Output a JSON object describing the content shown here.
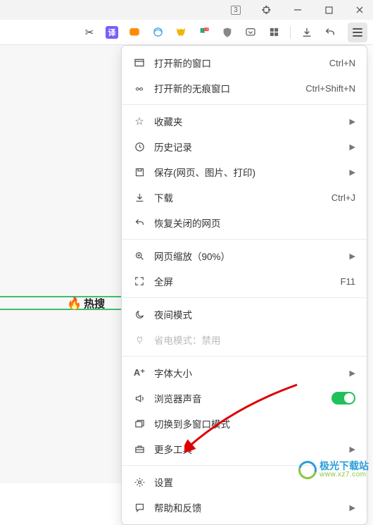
{
  "titlebar": {
    "tab_count": "3"
  },
  "toolbar": {
    "translate_label": "译"
  },
  "hot": {
    "label": "热搜"
  },
  "menu": {
    "new_window": {
      "label": "打开新的窗口",
      "shortcut": "Ctrl+N"
    },
    "new_incognito": {
      "label": "打开新的无痕窗口",
      "shortcut": "Ctrl+Shift+N"
    },
    "favorites": {
      "label": "收藏夹"
    },
    "history": {
      "label": "历史记录"
    },
    "save": {
      "label": "保存(网页、图片、打印)"
    },
    "download": {
      "label": "下载",
      "shortcut": "Ctrl+J"
    },
    "restore": {
      "label": "恢复关闭的网页"
    },
    "zoom": {
      "label": "网页缩放（90%）"
    },
    "fullscreen": {
      "label": "全屏",
      "shortcut": "F11"
    },
    "night": {
      "label": "夜间模式"
    },
    "power": {
      "label": "省电模式：禁用"
    },
    "font": {
      "label": "字体大小"
    },
    "sound": {
      "label": "浏览器声音"
    },
    "multiwindow": {
      "label": "切换到多窗口模式"
    },
    "moretools": {
      "label": "更多工具"
    },
    "settings": {
      "label": "设置"
    },
    "help": {
      "label": "帮助和反馈"
    }
  },
  "watermark": {
    "cn": "极光下载站",
    "en": "www.xz7.com"
  }
}
